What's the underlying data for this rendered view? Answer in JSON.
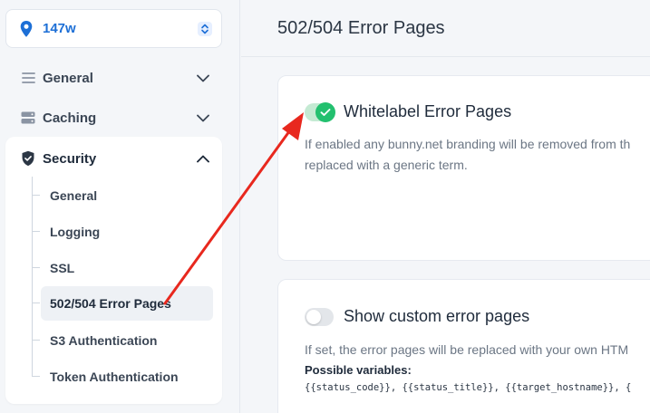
{
  "sidebar": {
    "zone_name": "147w",
    "nav": [
      {
        "label": "General",
        "icon": "list-icon"
      },
      {
        "label": "Caching",
        "icon": "server-icon"
      }
    ],
    "security": {
      "label": "Security",
      "items": [
        {
          "label": "General"
        },
        {
          "label": "Logging"
        },
        {
          "label": "SSL"
        },
        {
          "label": "502/504 Error Pages",
          "active": true
        },
        {
          "label": "S3 Authentication"
        },
        {
          "label": "Token Authentication"
        }
      ]
    }
  },
  "main": {
    "page_title": "502/504 Error Pages",
    "whitelabel": {
      "title": "Whitelabel Error Pages",
      "enabled": true,
      "description_line1": "If enabled any bunny.net branding will be removed from th",
      "description_line2": "replaced with a generic term."
    },
    "custom_pages": {
      "title": "Show custom error pages",
      "enabled": false,
      "description": "If set, the error pages will be replaced with your own HTM",
      "vars_label": "Possible variables:",
      "vars": "{{status_code}}, {{status_title}}, {{target_hostname}}, {"
    }
  },
  "colors": {
    "accent": "#1d6fd6",
    "toggle_on": "#23c06f",
    "annotation_arrow": "#e8281e"
  }
}
